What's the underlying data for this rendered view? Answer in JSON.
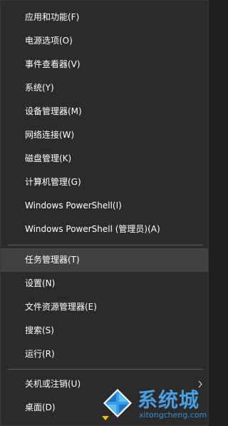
{
  "menu": {
    "items": [
      {
        "label": "应用和功能(F)"
      },
      {
        "label": "电源选项(O)"
      },
      {
        "label": "事件查看器(V)"
      },
      {
        "label": "系统(Y)"
      },
      {
        "label": "设备管理器(M)"
      },
      {
        "label": "网络连接(W)"
      },
      {
        "label": "磁盘管理(K)"
      },
      {
        "label": "计算机管理(G)"
      },
      {
        "label": "Windows PowerShell(I)"
      },
      {
        "label": "Windows PowerShell (管理员)(A)"
      },
      {
        "label": "任务管理器(T)"
      },
      {
        "label": "设置(N)"
      },
      {
        "label": "文件资源管理器(E)"
      },
      {
        "label": "搜索(S)"
      },
      {
        "label": "运行(R)"
      },
      {
        "label": "关机或注销(U)"
      },
      {
        "label": "桌面(D)"
      }
    ],
    "highlighted_item": "任务管理器(T)"
  },
  "watermark": {
    "title": "系统城",
    "subtitle": "xitongcheng.com",
    "icon": "windows-logo-icon"
  },
  "colors": {
    "menu_background": "#2b2b2b",
    "hover_background": "#414141",
    "separator": "#5a5a5a",
    "watermark_blue": "#4a9fe0"
  }
}
